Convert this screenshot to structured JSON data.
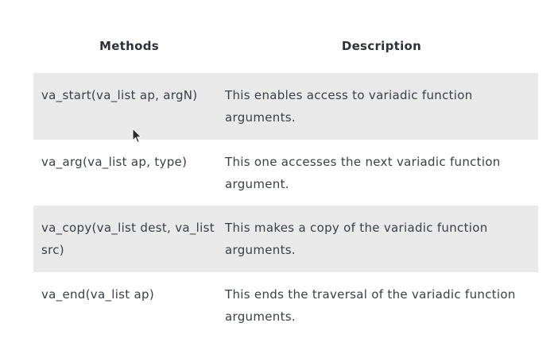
{
  "table": {
    "headers": {
      "methods": "Methods",
      "description": "Description"
    },
    "rows": [
      {
        "method": "va_start(va_list ap, argN)",
        "description": "This enables access to variadic function arguments."
      },
      {
        "method": "va_arg(va_list ap, type)",
        "description": "This one accesses the next variadic function argument."
      },
      {
        "method": "va_copy(va_list dest, va_list src)",
        "description": "This makes a copy of the variadic function arguments."
      },
      {
        "method": "va_end(va_list ap)",
        "description": "This ends the traversal of the variadic function arguments."
      }
    ]
  },
  "colors": {
    "shaded_row": "#e9e9e9",
    "text": "#3b4046",
    "header_text": "#2d3238"
  },
  "icons": {
    "cursor": "mouse-pointer-icon"
  }
}
